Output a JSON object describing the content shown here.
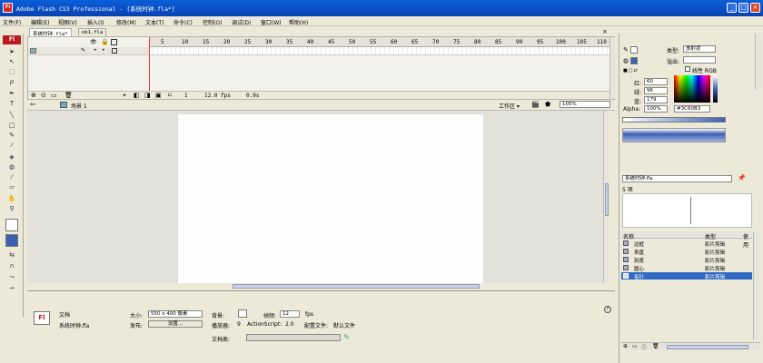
{
  "window": {
    "title": "Adobe Flash CS3 Professional - [系统时钟.fla*]",
    "logo": "Fl",
    "minimize": "_",
    "maximize": "□",
    "close": "×"
  },
  "menu": [
    "文件(F)",
    "编辑(E)",
    "视图(V)",
    "插入(I)",
    "修改(M)",
    "文本(T)",
    "命令(C)",
    "控制(O)",
    "调试(D)",
    "窗口(W)",
    "帮助(H)"
  ],
  "doc_tabs": [
    "系统时钟.fla*",
    "ok1.fla"
  ],
  "timeline": {
    "ruler": [
      "5",
      "10",
      "15",
      "20",
      "25",
      "30",
      "35",
      "40",
      "45",
      "50",
      "55",
      "60",
      "65",
      "70",
      "75",
      "80",
      "85",
      "90",
      "95",
      "100",
      "105",
      "110"
    ],
    "frame": "1",
    "fps": "12.0 fps",
    "time": "0.0s"
  },
  "edit_bar": {
    "scene": "场景 1",
    "workspace": "工作区 ▾",
    "zoom": "105%"
  },
  "tools": {
    "logo": "Fl",
    "icons": [
      "arrow-icon",
      "subselect-icon",
      "free-transform-icon",
      "lasso-icon",
      "pen-icon",
      "text-icon",
      "line-icon",
      "rectangle-icon",
      "pencil-icon",
      "brush-icon",
      "ink-bottle-icon",
      "paint-bucket-icon",
      "eyedropper-icon",
      "eraser-icon",
      "hand-icon",
      "zoom-icon"
    ]
  },
  "properties": {
    "type": "文档",
    "filename": "系统时钟.fla",
    "size_label": "大小:",
    "size_value": "550 x 400 像素",
    "publish_label": "发布:",
    "settings_button": "设置...",
    "background_label": "背景:",
    "framerate_label": "帧频:",
    "framerate_value": "12",
    "fps_unit": "fps",
    "player_label": "播放器:",
    "player_value": "9",
    "actionscript_label": "ActionScript:",
    "actionscript_value": "2.0",
    "profile_label": "配置文件:",
    "profile_value": "默认文件",
    "docclass_label": "文档类:",
    "help": "?"
  },
  "color_panel": {
    "type_label": "类型:",
    "type_value": "放射状",
    "overflow_label": "溢出:",
    "linear_rgb": "线性 RGB",
    "red_label": "红:",
    "red_value": "60",
    "green_label": "绿:",
    "green_value": "96",
    "blue_label": "蓝:",
    "blue_value": "179",
    "alpha_label": "Alpha:",
    "alpha_value": "100%",
    "hex_value": "#3C60B3",
    "gradient_colors": [
      "#ffffff",
      "#3c60b3"
    ]
  },
  "library": {
    "document": "系统时钟.fla",
    "count": "5 项",
    "col_name": "名称",
    "col_type": "类型",
    "col_use": "使用",
    "items": [
      {
        "name": "边框",
        "type": "影片剪辑"
      },
      {
        "name": "表盘",
        "type": "影片剪辑"
      },
      {
        "name": "刻度",
        "type": "影片剪辑"
      },
      {
        "name": "圆心",
        "type": "影片剪辑"
      },
      {
        "name": "指针",
        "type": "影片剪辑"
      }
    ]
  }
}
